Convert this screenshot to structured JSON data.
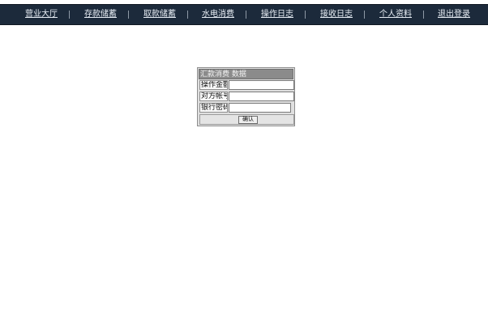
{
  "nav": {
    "items": [
      {
        "label": "营业大厅"
      },
      {
        "label": "存款储蓄"
      },
      {
        "label": "取款储蓄"
      },
      {
        "label": "水电消费"
      },
      {
        "label": "操作日志"
      },
      {
        "label": "接收日志"
      },
      {
        "label": "个人资料"
      },
      {
        "label": "退出登录"
      }
    ],
    "separator": "|"
  },
  "form": {
    "title": "汇款消费 数据",
    "rows": [
      {
        "label": "操作金额",
        "value": "",
        "placeholder": ""
      },
      {
        "label": "对方帐号",
        "value": "",
        "placeholder": ""
      },
      {
        "label": "银行密码",
        "value": "",
        "placeholder": ""
      }
    ],
    "confirm_label": "确认"
  },
  "colors": {
    "nav_background": "#1c2a3b",
    "panel_background": "#e0e0e0",
    "panel_header": "#8b8b8b"
  }
}
